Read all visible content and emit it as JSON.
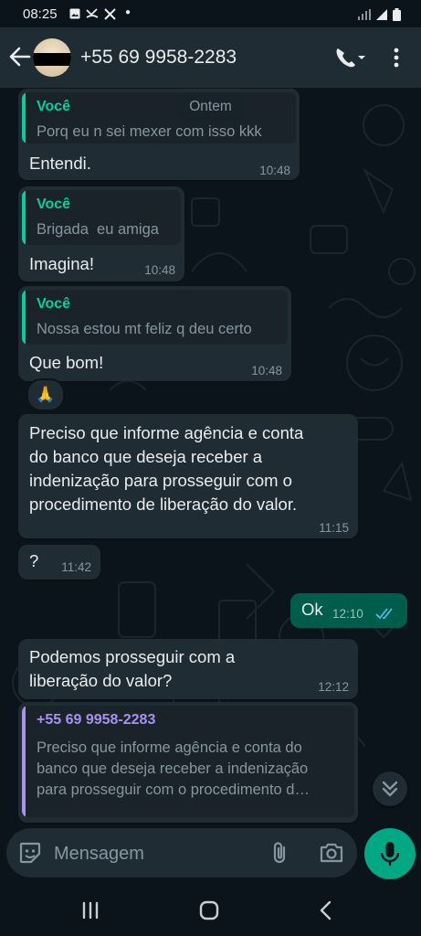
{
  "status_bar": {
    "time": "08:25",
    "notif_icons": [
      "image-icon",
      "missed-call-icon",
      "tools-icon",
      "dot-icon"
    ],
    "right_icons": [
      "wifi-icon",
      "signal-icon",
      "battery-icon"
    ]
  },
  "header": {
    "contact": "+55 69 9958-2283",
    "icons": [
      "back-arrow-icon",
      "avatar",
      "phone-icon",
      "menu-dots-icon"
    ]
  },
  "date_chip": "Ontem",
  "messages": [
    {
      "dir": "in",
      "quote_author": "Você",
      "quote_text": "Porq eu n sei mexer com isso kkk",
      "text": "Entendi.",
      "time": "10:48"
    },
    {
      "dir": "in",
      "quote_author": "Você",
      "quote_text": "Brigada  eu amiga",
      "text": "Imagina!",
      "time": "10:48"
    },
    {
      "dir": "in",
      "quote_author": "Você",
      "quote_text": "Nossa estou mt feliz q deu certo",
      "text": "Que bom!",
      "time": "10:48",
      "reaction": "🙏"
    },
    {
      "dir": "in",
      "text_lines": [
        "Preciso que informe agência e conta",
        "do banco que deseja receber a",
        "indenização para prosseguir com o",
        "procedimento de liberação do valor."
      ],
      "time": "11:15"
    },
    {
      "dir": "in",
      "text": "?",
      "time": "11:42"
    },
    {
      "dir": "out",
      "text": "Ok",
      "time": "12:10",
      "status": "read"
    },
    {
      "dir": "in",
      "text_lines": [
        "Podemos prosseguir com a",
        "liberação do valor?"
      ],
      "time": "12:12"
    },
    {
      "dir": "in",
      "quote_author": "+55 69 9958-2283",
      "quote_lines": [
        "Preciso que informe agência e conta do",
        "banco que deseja receber a indenização",
        "para prosseguir com o procedimento d…"
      ]
    }
  ],
  "composer": {
    "placeholder": "Mensagem",
    "icons": [
      "emoji-sticker-icon",
      "attach-icon",
      "camera-icon",
      "mic-icon"
    ]
  },
  "nav_bar": {
    "icons": [
      "recent-apps-icon",
      "home-icon",
      "back-icon"
    ]
  },
  "colors": {
    "background": "#0b141a",
    "header": "#1f2c34",
    "incoming_bubble": "#202c33",
    "outgoing_bubble": "#005c4b",
    "accent": "#00a884",
    "quote_author_green": "#06cf9c",
    "quote_author_purple": "#a791f1",
    "read_ticks": "#53bdeb"
  }
}
